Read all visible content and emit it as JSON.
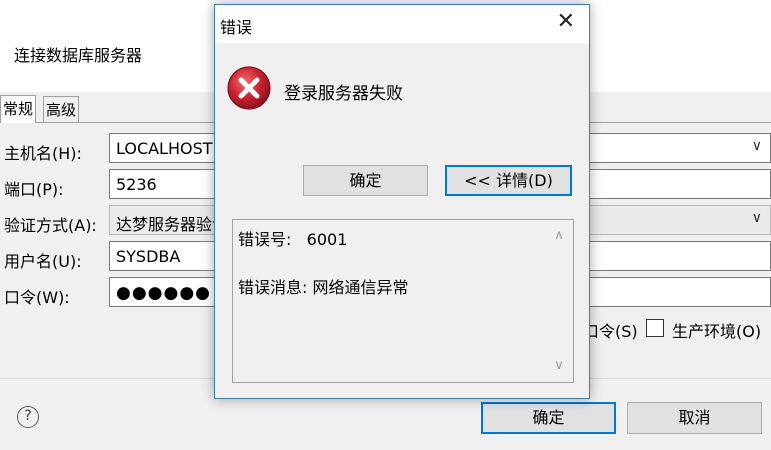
{
  "bg_dialog": {
    "title": "连接数据库服务器",
    "tabs": [
      "常规",
      "高级"
    ],
    "fields": {
      "host_label": "主机名(H):",
      "host_value": "LOCALHOST",
      "port_label": "端口(P):",
      "port_value": "5236",
      "auth_label": "验证方式(A):",
      "auth_value": "达梦服务器验证",
      "user_label": "用户名(U):",
      "user_value": "SYSDBA",
      "pwd_label": "口令(W):",
      "pwd_value": "●●●●●●"
    },
    "save_pwd_label": "口令(S)",
    "prod_env_label": "生产环境(O)",
    "ok_button": "确定",
    "cancel_button": "取消",
    "help_glyph": "?",
    "chevron": "∨"
  },
  "error_modal": {
    "title": "错误",
    "close_glyph": "✕",
    "message": "登录服务器失败",
    "ok_button": "确定",
    "details_button": "<< 详情(D)",
    "detail_code_label": "错误号:",
    "detail_code_value": "6001",
    "detail_message": "错误消息: 网络通信异常",
    "scroll_up": "∧",
    "scroll_down": "∨"
  },
  "colors": {
    "accent": "#0078d7",
    "error_red": "#c7202f",
    "window_bg": "#f0f0f0"
  }
}
